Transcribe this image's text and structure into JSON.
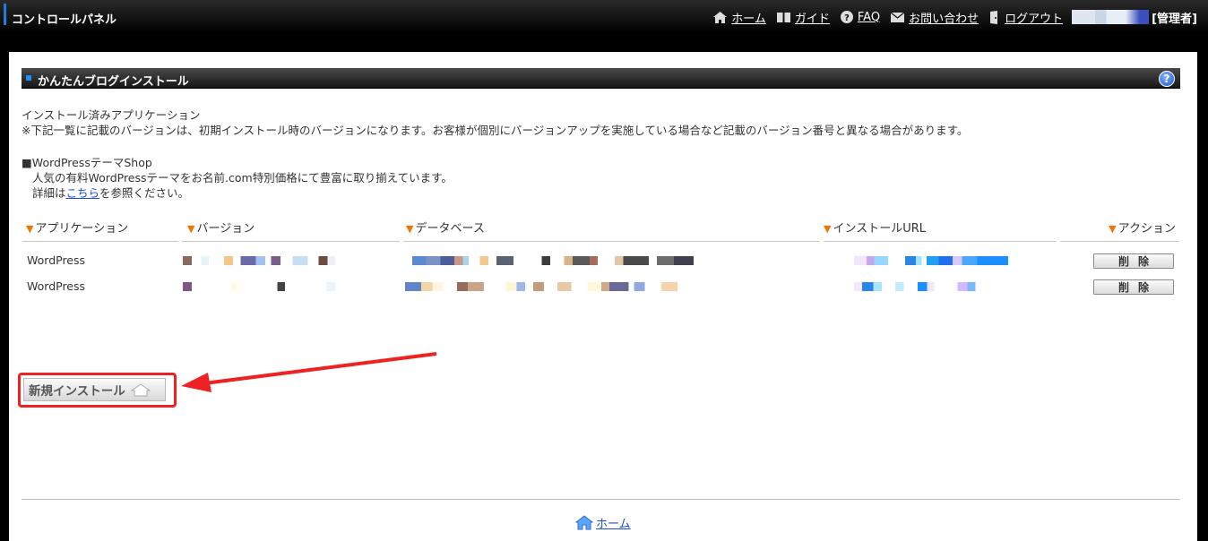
{
  "topbar": {
    "title": "コントロールパネル",
    "nav": [
      {
        "label": "ホーム",
        "icon": "home-icon"
      },
      {
        "label": "ガイド",
        "icon": "book-icon"
      },
      {
        "label": "FAQ",
        "icon": "question-icon"
      },
      {
        "label": "お問い合わせ",
        "icon": "mail-icon"
      },
      {
        "label": "ログアウト",
        "icon": "logout-icon"
      }
    ],
    "role": "[管理者]"
  },
  "section": {
    "title": "かんたんブログインストール",
    "help": "?"
  },
  "intro": {
    "heading": "インストール済みアプリケーション",
    "note": "※下記一覧に記載のバージョンは、初期インストール時のバージョンになります。お客様が個別にバージョンアップを実施している場合など記載のバージョン番号と異なる場合があります。"
  },
  "shop": {
    "title": "■WordPressテーマShop",
    "desc": "人気の有料WordPressテーマをお名前.com特別価格にて豊富に取り揃えています。",
    "detail_prefix": "詳細は",
    "detail_link": "こちら",
    "detail_suffix": "を参照ください。"
  },
  "table": {
    "headers": [
      "アプリケーション",
      "バージョン",
      "データベース",
      "インストールURL",
      "アクション"
    ],
    "rows": [
      {
        "application": "WordPress",
        "action": "削除"
      },
      {
        "application": "WordPress",
        "action": "削除"
      }
    ]
  },
  "new_install_label": "新規インストール",
  "footer": {
    "home": "ホーム"
  },
  "colors": {
    "accent": "#1c8ef0",
    "highlight": "#e22222",
    "header_triangle": "#ee7600"
  }
}
